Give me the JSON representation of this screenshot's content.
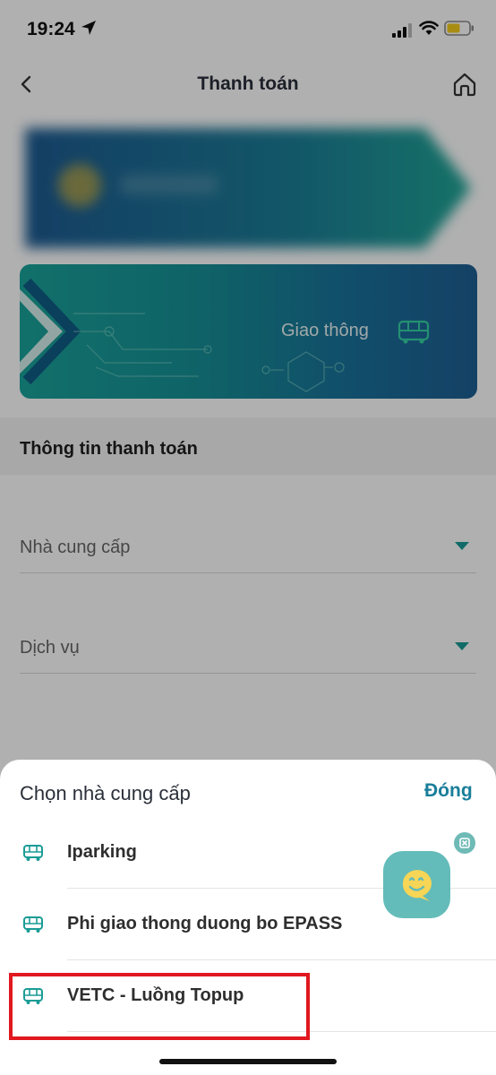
{
  "status_bar": {
    "time": "19:24"
  },
  "header": {
    "title": "Thanh toán"
  },
  "banner": {
    "label": "Giao thông"
  },
  "section": {
    "title": "Thông tin thanh toán"
  },
  "form": {
    "provider_label": "Nhà cung cấp",
    "service_label": "Dịch vụ"
  },
  "sheet": {
    "title": "Chọn nhà cung cấp",
    "close_label": "Đóng",
    "items": [
      {
        "label": "Iparking",
        "icon": "bus-icon"
      },
      {
        "label": "Phi giao thong duong bo EPASS",
        "icon": "bus-icon"
      },
      {
        "label": "VETC - Luồng Topup",
        "icon": "bus-icon"
      }
    ]
  },
  "colors": {
    "accent": "#1a9c95",
    "close_text": "#1a7e9a",
    "highlight": "#e1181f",
    "chat_fab": "#58b8b4",
    "chat_face": "#f7d24a"
  },
  "icons": {
    "back": "chevron-left-icon",
    "home": "home-icon",
    "location": "location-arrow-icon",
    "signal": "signal-icon",
    "wifi": "wifi-icon",
    "battery": "battery-icon",
    "chat": "chat-bot-icon",
    "chat_close": "close-icon"
  }
}
